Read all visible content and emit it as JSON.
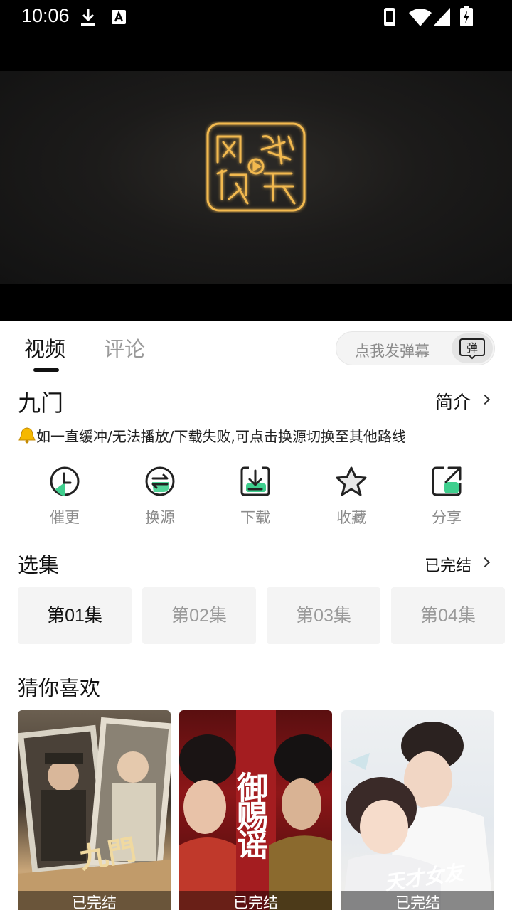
{
  "status_bar": {
    "time": "10:06"
  },
  "player": {
    "logo_name": "网络视听-logo"
  },
  "tabs": [
    {
      "label": "视频",
      "active": true
    },
    {
      "label": "评论",
      "active": false
    }
  ],
  "danmu": {
    "placeholder": "点我发弹幕",
    "button_label": "弹"
  },
  "show": {
    "title": "九门",
    "intro_label": "简介"
  },
  "notice": {
    "icon": "bell-icon",
    "text": "如一直缓冲/无法播放/下载失败,可点击换源切换至其他路线"
  },
  "actions": [
    {
      "label": "催更",
      "icon": "clock-icon"
    },
    {
      "label": "换源",
      "icon": "switch-icon"
    },
    {
      "label": "下载",
      "icon": "download-icon"
    },
    {
      "label": "收藏",
      "icon": "star-icon"
    },
    {
      "label": "分享",
      "icon": "share-icon"
    }
  ],
  "episodes": {
    "title": "选集",
    "status": "已完结",
    "items": [
      "第01集",
      "第02集",
      "第03集",
      "第04集"
    ],
    "selected_index": 0
  },
  "recommend": {
    "title": "猜你喜欢",
    "items": [
      {
        "badge": "已完结",
        "poster_text": "九門"
      },
      {
        "badge": "已完结",
        "poster_text": "御赐谣"
      },
      {
        "badge": "已完结",
        "poster_text": "天才女友"
      }
    ]
  },
  "colors": {
    "accent": "#3fcf8e",
    "logo_gold": "#f2b950"
  }
}
